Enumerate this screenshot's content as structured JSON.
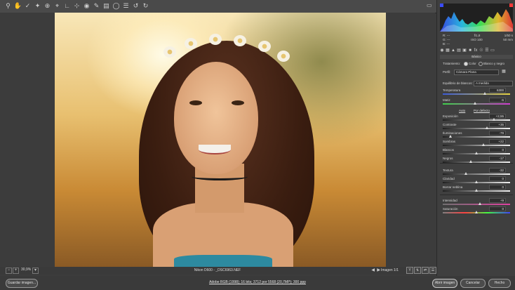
{
  "toolbar": {
    "icons": [
      "zoom-icon",
      "hand-icon",
      "white-balance-icon",
      "color-sampler-icon",
      "target-adjust-icon",
      "crop-icon",
      "straighten-icon",
      "spot-removal-icon",
      "red-eye-icon",
      "adjustment-brush-icon",
      "graduated-filter-icon",
      "radial-filter-icon",
      "preferences-icon",
      "rotate-left-icon",
      "rotate-right-icon"
    ],
    "fullscreen_icon": "fullscreen-icon"
  },
  "status": {
    "zoom": "30,9%",
    "file": "Nikon D600  -  _DSC6963.NEF",
    "image_counter": "Imagen 1/1"
  },
  "bottom": {
    "save_label": "Guardar imagen...",
    "workflow_link": "Adobe RGB (1998); 16 bits; 3712 por 5568 (20,7MP); 300 ppp",
    "open_label": "Abrir imagen",
    "cancel_label": "Cancelar",
    "done_label": "Hecho"
  },
  "panel": {
    "readout": {
      "r_label": "R:",
      "r_val": "---",
      "g_label": "G:",
      "g_val": "---",
      "b_label": "B:",
      "b_val": "---",
      "aperture": "f/1,8",
      "shutter": "1/50 s",
      "iso": "ISO 100",
      "focal": "50 mm"
    },
    "section_title": "Básico",
    "treatment_label": "Tratamiento:",
    "color_label": "Color",
    "bw_label": "Blanco y negro",
    "profile_label": "Perfil:",
    "profile_value": "Cámara Plana",
    "wb_label": "Equilibrio de blancos:",
    "wb_value": "A medida",
    "auto_link": "Auto",
    "default_link": "Por defecto",
    "sliders": [
      {
        "label": "Temperatura",
        "value": "6300",
        "pos": 0.62
      },
      {
        "label": "Matiz",
        "value": "-6",
        "pos": 0.48
      },
      {
        "label": "Exposición",
        "value": "+2,55",
        "pos": 0.76
      },
      {
        "label": "Contraste",
        "value": "+35",
        "pos": 0.66
      },
      {
        "label": "Iluminaciones",
        "value": "-79",
        "pos": 0.11
      },
      {
        "label": "Sombras",
        "value": "+22",
        "pos": 0.6
      },
      {
        "label": "Blancos",
        "value": "0",
        "pos": 0.5
      },
      {
        "label": "Negros",
        "value": "-17",
        "pos": 0.42
      },
      {
        "label": "Textura",
        "value": "-32",
        "pos": 0.34
      },
      {
        "label": "Claridad",
        "value": "0",
        "pos": 0.5
      },
      {
        "label": "Borrar neblina",
        "value": "0",
        "pos": 0.5
      },
      {
        "label": "Intensidad",
        "value": "+9",
        "pos": 0.55
      },
      {
        "label": "Saturación",
        "value": "0",
        "pos": 0.5
      }
    ]
  }
}
